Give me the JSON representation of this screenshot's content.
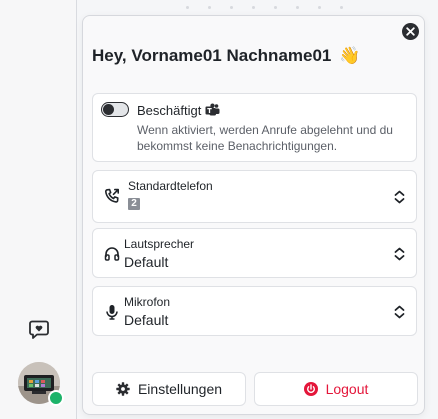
{
  "profile_panel": {
    "greeting": "Hey, Vorname01 Nachname01",
    "greeting_emoji": "👋",
    "busy": {
      "label": "Beschäftigt",
      "enabled": false,
      "description": "Wenn aktiviert, werden Anrufe abgelehnt und du bekommst keine Benachrichtigungen."
    },
    "devices": [
      {
        "label": "Standardtelefon",
        "value": "2",
        "icon": "phone-transfer-icon"
      },
      {
        "label": "Lautsprecher",
        "value": "Default",
        "icon": "headphones-icon"
      },
      {
        "label": "Mikrofon",
        "value": "Default",
        "icon": "microphone-icon"
      }
    ],
    "settings_label": "Einstellungen",
    "logout_label": "Logout"
  },
  "colors": {
    "logout": "#e4163a",
    "presence_online": "#1db36a",
    "dark": "#2b2d31"
  }
}
